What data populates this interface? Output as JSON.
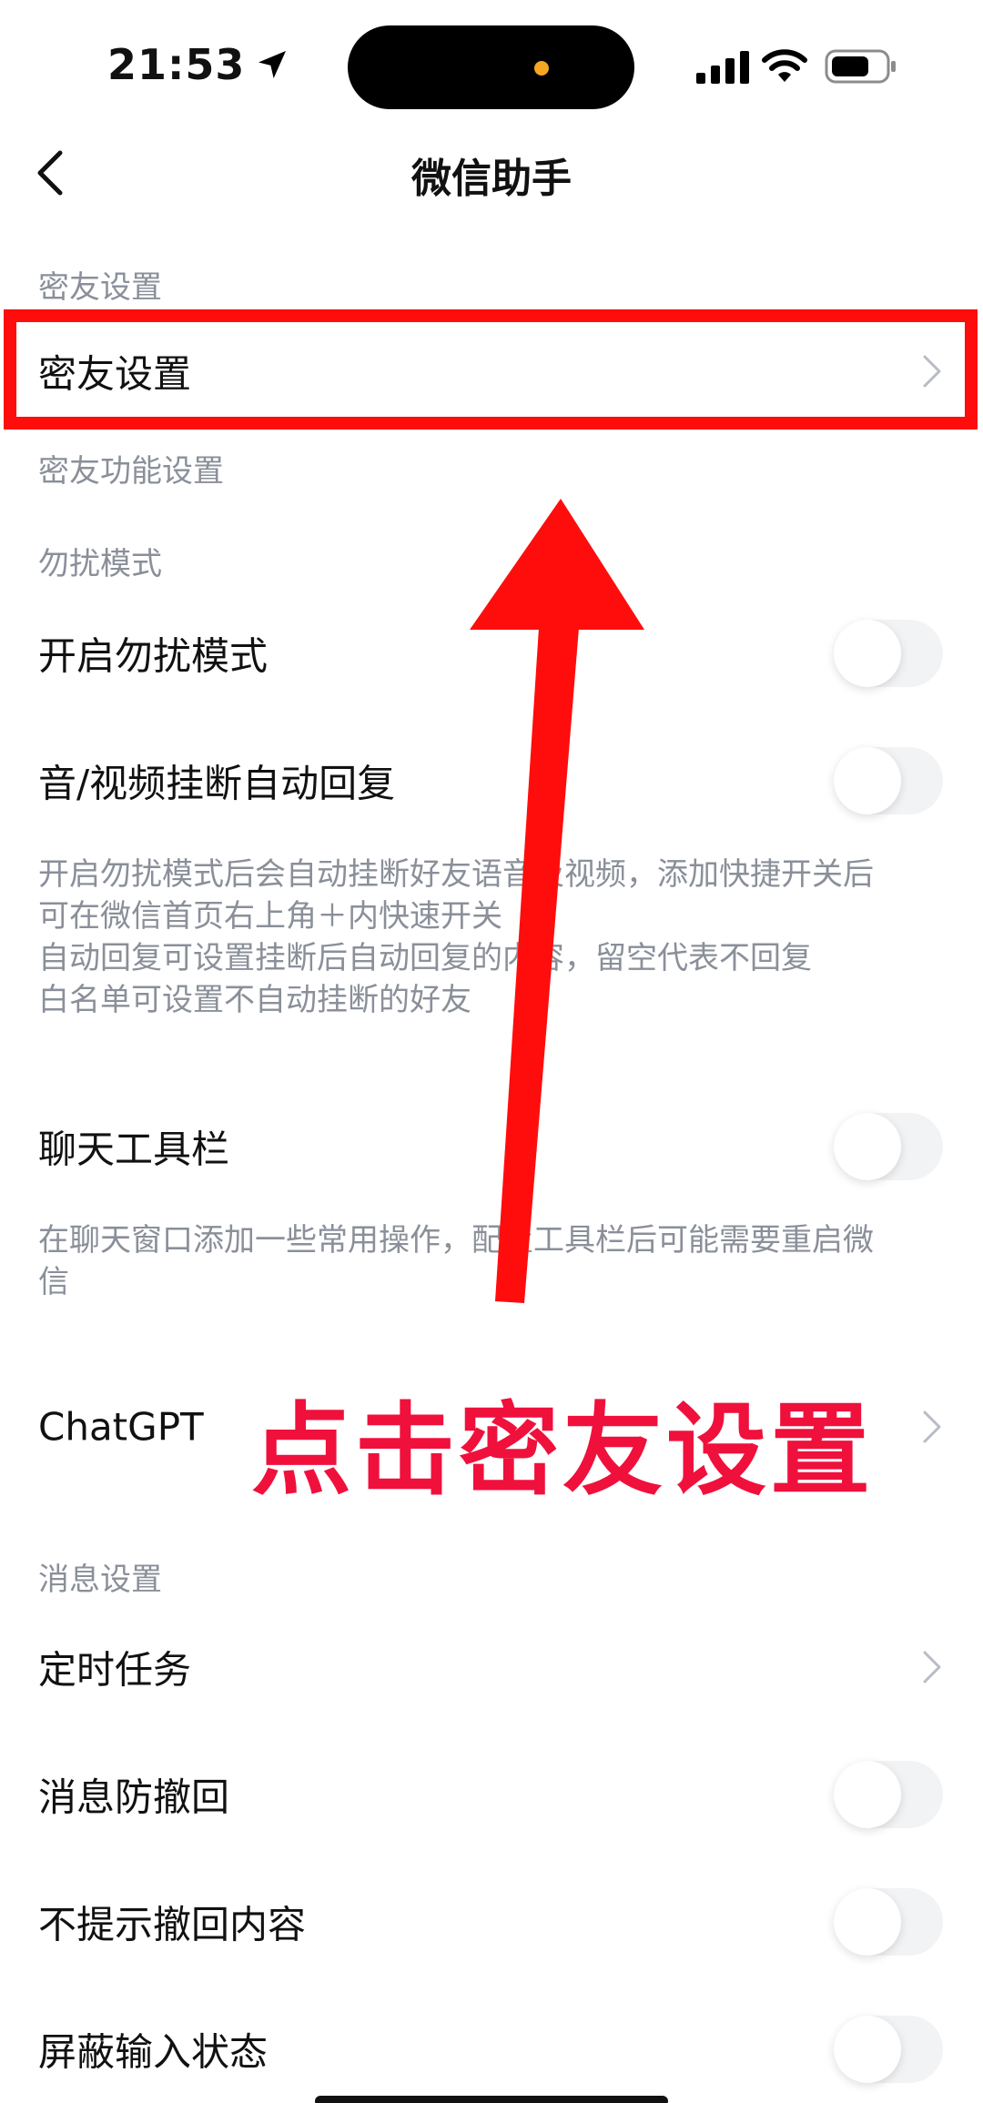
{
  "status_bar": {
    "time": "21:53",
    "icons": [
      "location-arrow-icon",
      "cellular-signal-icon",
      "wifi-icon",
      "battery-icon"
    ],
    "island_dot_color": "#f5a623"
  },
  "nav": {
    "title": "微信助手",
    "back_icon": "chevron-left-icon"
  },
  "sections": {
    "mi_you_header": "密友设置",
    "mi_you_row": "密友设置",
    "mi_you_func_header": "密友功能设置",
    "dnd_header": "勿扰模式",
    "dnd_row": "开启勿扰模式",
    "auto_reply_row": "音/视频挂断自动回复",
    "dnd_desc": [
      "开启勿扰模式后会自动挂断好友语音及视频，添加快捷开关后",
      "可在微信首页右上角＋内快速开关",
      "自动回复可设置挂断后自动回复的内容，留空代表不回复",
      "白名单可设置不自动挂断的好友"
    ],
    "chat_toolbar_row": "聊天工具栏",
    "chat_toolbar_desc": [
      "在聊天窗口添加一些常用操作，配置工具栏后可能需要重启微",
      "信"
    ],
    "chatgpt_row": "ChatGPT",
    "msg_header": "消息设置",
    "scheduled_task_row": "定时任务",
    "anti_recall_row": "消息防撤回",
    "no_recall_content_row": "不提示撤回内容",
    "block_typing_row": "屏蔽输入状态"
  },
  "toggles": {
    "dnd": false,
    "auto_reply": false,
    "chat_toolbar": false,
    "anti_recall": false,
    "no_recall_content": false,
    "block_typing": false
  },
  "annotation": {
    "text": "点击密友设置",
    "color": "#f0103c",
    "box_color": "#ff0d0d"
  }
}
